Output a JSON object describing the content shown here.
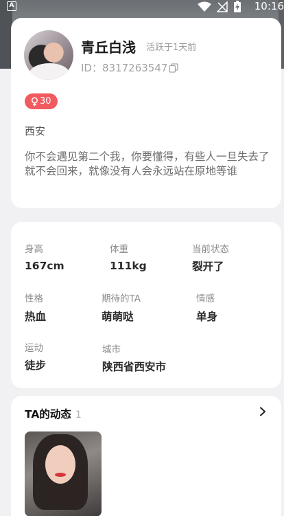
{
  "status_bar": {
    "time": "10:16",
    "sim_icon": "sim-a-icon",
    "icons": [
      "wifi-icon",
      "no-signal-icon",
      "battery-charging-icon"
    ]
  },
  "profile": {
    "nickname": "青丘白浅",
    "active_status": "活跃于1天前",
    "user_id": "ID：8317263547",
    "gender_age": "30",
    "gender_icon": "female-icon",
    "city": "西安",
    "bio": "你不会遇见第二个我，你要懂得，有些人一旦失去了就不会回来，就像没有人会永远站在原地等谁"
  },
  "details": {
    "height": {
      "label": "身高",
      "value": "167cm"
    },
    "weight": {
      "label": "体重",
      "value": "111kg"
    },
    "status": {
      "label": "当前状态",
      "value": "裂开了"
    },
    "personality": {
      "label": "性格",
      "value": "热血"
    },
    "expected_ta": {
      "label": "期待的TA",
      "value": "萌萌哒"
    },
    "emotion": {
      "label": "情感",
      "value": "单身"
    },
    "sport": {
      "label": "运动",
      "value": "徒步"
    },
    "city": {
      "label": "城市",
      "value": "陕西省西安市"
    }
  },
  "moments": {
    "title": "TA的动态",
    "count": "1"
  },
  "colors": {
    "badge": "#f15a5f",
    "background": "#f1f1f3"
  }
}
